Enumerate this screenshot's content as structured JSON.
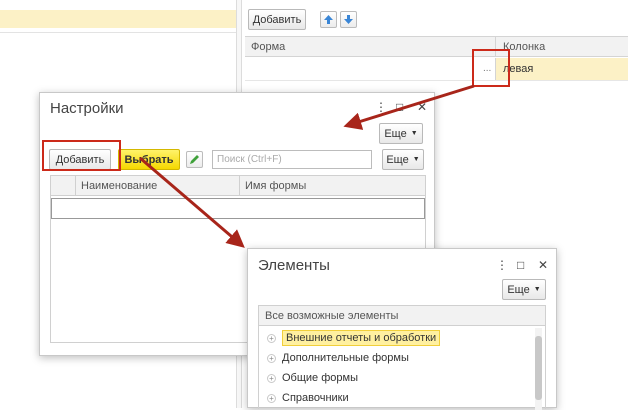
{
  "background_form": {
    "add_button": "Добавить",
    "table_headers": {
      "form": "Форма",
      "column": "Колонка"
    },
    "row": {
      "dots": "...",
      "column_value": "левая"
    }
  },
  "settings_dialog": {
    "title": "Настройки",
    "more_top": "Еще",
    "add_button": "Добавить",
    "select_button": "Выбрать",
    "search_placeholder": "Поиск (Ctrl+F)",
    "search_clear": "×",
    "more": "Еще",
    "columns": {
      "name": "Наименование",
      "form_name": "Имя формы"
    }
  },
  "elements_dialog": {
    "title": "Элементы",
    "more": "Еще",
    "tree_header": "Все возможные элементы",
    "items": [
      {
        "label": "Внешние отчеты и обработки",
        "selected": true
      },
      {
        "label": "Дополнительные формы",
        "selected": false
      },
      {
        "label": "Общие формы",
        "selected": false
      },
      {
        "label": "Справочники",
        "selected": false
      }
    ]
  },
  "window_controls": {
    "menu": "⋮",
    "maximize": "□",
    "close": "✕"
  },
  "colors": {
    "highlight_box": "#cc2a1a",
    "arrow": "#a8251a",
    "selection": "#fff0a0",
    "row_fill": "#fcf1c6"
  }
}
